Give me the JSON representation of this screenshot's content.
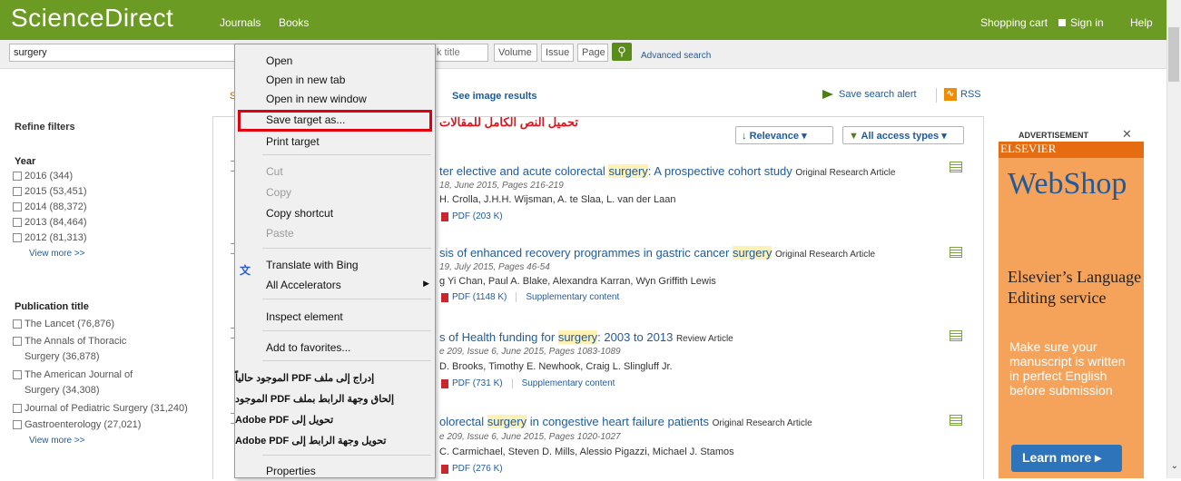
{
  "header": {
    "logo": "ScienceDirect",
    "nav": [
      "Journals",
      "Books"
    ],
    "shopping_cart": "Shopping cart",
    "sign_in": "Sign in",
    "help": "Help"
  },
  "search": {
    "query": "surgery",
    "journal_placeholder": "k title",
    "volume": "Volume",
    "issue": "Issue",
    "page": "Page",
    "advanced": "Advanced search"
  },
  "toolbar": {
    "s_label": "S",
    "image_results": "See image results",
    "save_alert": "Save search alert",
    "rss": "RSS"
  },
  "filters": {
    "refine": "Refine filters",
    "year_title": "Year",
    "years": [
      "2016 (344)",
      "2015 (53,451)",
      "2014 (88,372)",
      "2013 (84,464)",
      "2012 (81,313)"
    ],
    "view_more": "View more >>",
    "pub_title": "Publication title",
    "publications": [
      "The Lancet  (76,876)",
      "The Annals of Thoracic Surgery  (36,878)",
      "The American Journal of Surgery  (34,308)",
      "Journal of Pediatric Surgery  (31,240)",
      "Gastroenterology  (27,021)"
    ]
  },
  "sort": {
    "arabic_note": "تحميل النص الكامل للمقالات",
    "relevance": "Relevance",
    "access": "All access types"
  },
  "results": [
    {
      "pre": "ter elective and acute colorectal ",
      "hl": "surgery",
      "post": ": A prospective cohort study",
      "type": "Original Research Article",
      "meta": "18, June 2015, Pages 216-219",
      "authors": "H. Crolla, J.H.H. Wijsman, A. te Slaa, L. van der Laan",
      "pdf": "PDF (203 K)",
      "supp": ""
    },
    {
      "pre": "sis of enhanced recovery programmes in gastric cancer ",
      "hl": "surgery",
      "post": "",
      "type": "Original Research Article",
      "meta": "19, July 2015, Pages 46-54",
      "authors": "g Yi Chan, Paul A. Blake, Alexandra Karran, Wyn Griffith Lewis",
      "pdf": "PDF (1148 K)",
      "supp": "Supplementary content"
    },
    {
      "pre": "s of Health funding for ",
      "hl": "surgery",
      "post": ": 2003 to 2013",
      "type": "Review Article",
      "meta": "e 209, Issue 6, June 2015, Pages 1083-1089",
      "authors": "D. Brooks, Timothy E. Newhook, Craig L. Slingluff Jr.",
      "pdf": "PDF (731 K)",
      "supp": "Supplementary content"
    },
    {
      "pre": "olorectal ",
      "hl": "surgery",
      "post": " in congestive heart failure patients",
      "type": "Original Research Article",
      "meta": "e 209, Issue 6, June 2015, Pages 1020-1027",
      "authors": "C. Carmichael, Steven D. Mills, Alessio Pigazzi, Michael J. Stamos",
      "pdf": "PDF (276 K)",
      "supp": ""
    }
  ],
  "ad": {
    "label": "ADVERTISEMENT",
    "close": "✕",
    "brand": "ELSEVIER",
    "webshop": "WebShop",
    "headline": "Elsevier’s Language Editing service",
    "copy": "Make sure your manuscript is written in perfect English before submission",
    "button": "Learn more"
  },
  "context_menu": {
    "open": "Open",
    "open_tab": "Open in new tab",
    "open_window": "Open in new window",
    "save_target": "Save target as...",
    "print_target": "Print target",
    "cut": "Cut",
    "copy": "Copy",
    "copy_shortcut": "Copy shortcut",
    "paste": "Paste",
    "translate": "Translate with Bing",
    "accelerators": "All Accelerators",
    "inspect": "Inspect element",
    "favorites": "Add to favorites...",
    "ar1": "إدراج إلى ملف PDF الموجود حالياً",
    "ar2": "إلحاق وجهة الرابط بملف PDF الموجود",
    "ar3": "تحويل إلى Adobe PDF",
    "ar4": "تحويل وجهة الرابط إلى Adobe PDF",
    "properties": "Properties"
  },
  "colors": {
    "brand_green": "#6b9b22",
    "link_blue": "#1f5a9e",
    "highlight": "#e00010"
  }
}
